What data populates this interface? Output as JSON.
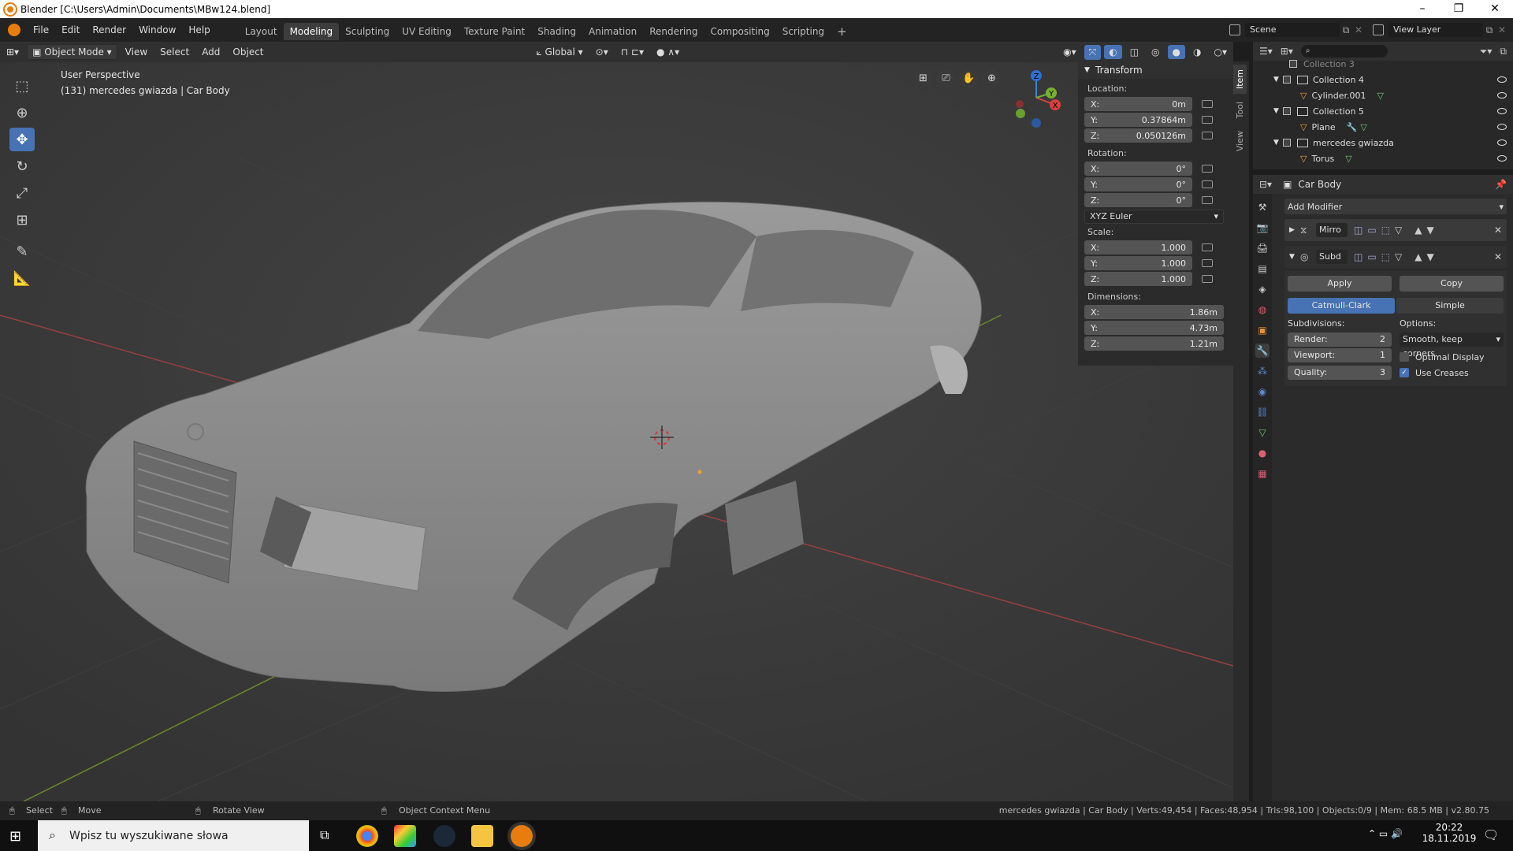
{
  "window": {
    "title": "Blender [C:\\Users\\Admin\\Documents\\MBw124.blend]",
    "controls": [
      "–",
      "❐",
      "✕"
    ]
  },
  "menu": {
    "items": [
      "File",
      "Edit",
      "Render",
      "Window",
      "Help"
    ]
  },
  "workspaces": {
    "tabs": [
      "Layout",
      "Modeling",
      "Sculpting",
      "UV Editing",
      "Texture Paint",
      "Shading",
      "Animation",
      "Rendering",
      "Compositing",
      "Scripting"
    ],
    "active": "Modeling",
    "add": "+"
  },
  "topright": {
    "scene": "Scene",
    "view_layer": "View Layer"
  },
  "viewport_header": {
    "mode": "Object Mode",
    "menus": [
      "View",
      "Select",
      "Add",
      "Object"
    ],
    "orientation": "Global"
  },
  "viewport": {
    "perspective": "User Perspective",
    "object_info": "(131) mercedes gwiazda | Car Body",
    "axes": {
      "x": "X",
      "y": "Y",
      "z": "Z"
    }
  },
  "npanel": {
    "title": "Transform",
    "location_label": "Location:",
    "location": [
      {
        "axis": "X:",
        "value": "0m"
      },
      {
        "axis": "Y:",
        "value": "0.37864m"
      },
      {
        "axis": "Z:",
        "value": "0.050126m"
      }
    ],
    "rotation_label": "Rotation:",
    "rotation": [
      {
        "axis": "X:",
        "value": "0°"
      },
      {
        "axis": "Y:",
        "value": "0°"
      },
      {
        "axis": "Z:",
        "value": "0°"
      }
    ],
    "rotation_mode": "XYZ Euler",
    "scale_label": "Scale:",
    "scale": [
      {
        "axis": "X:",
        "value": "1.000"
      },
      {
        "axis": "Y:",
        "value": "1.000"
      },
      {
        "axis": "Z:",
        "value": "1.000"
      }
    ],
    "dimensions_label": "Dimensions:",
    "dimensions": [
      {
        "axis": "X:",
        "value": "1.86m"
      },
      {
        "axis": "Y:",
        "value": "4.73m"
      },
      {
        "axis": "Z:",
        "value": "1.21m"
      }
    ],
    "tabs": [
      "Item",
      "Tool",
      "View"
    ]
  },
  "outliner": {
    "rows": [
      {
        "name": "Collection 3",
        "indent": 0,
        "type": "collection"
      },
      {
        "name": "Collection 4",
        "indent": 0,
        "type": "collection"
      },
      {
        "name": "Cylinder.001",
        "indent": 1,
        "type": "object"
      },
      {
        "name": "Collection 5",
        "indent": 0,
        "type": "collection"
      },
      {
        "name": "Plane",
        "indent": 1,
        "type": "object"
      },
      {
        "name": "mercedes gwiazda",
        "indent": 0,
        "type": "collection"
      },
      {
        "name": "Torus",
        "indent": 1,
        "type": "object"
      }
    ]
  },
  "properties": {
    "object_name": "Car Body",
    "add_modifier": "Add Modifier",
    "modifiers": [
      {
        "name": "Mirro"
      },
      {
        "name": "Subd"
      }
    ],
    "apply": "Apply",
    "copy": "Copy",
    "catmull": "Catmull-Clark",
    "simple": "Simple",
    "subdivisions_label": "Subdivisions:",
    "options_label": "Options:",
    "render_label": "Render:",
    "render_value": "2",
    "viewport_label": "Viewport:",
    "viewport_value": "1",
    "quality_label": "Quality:",
    "quality_value": "3",
    "uv_smooth": "Smooth, keep corners",
    "optimal_display": "Optimal Display",
    "use_creases": "Use Creases"
  },
  "statusbar": {
    "select": "Select",
    "move": "Move",
    "rotate": "Rotate View",
    "context": "Object Context Menu",
    "stats": "mercedes gwiazda | Car Body | Verts:49,454 | Faces:48,954 | Tris:98,100 | Objects:0/9 | Mem: 68.5 MB | v2.80.75"
  },
  "taskbar": {
    "search_placeholder": "Wpisz tu wyszukiwane słowa",
    "time": "20:22",
    "date": "18.11.2019"
  }
}
